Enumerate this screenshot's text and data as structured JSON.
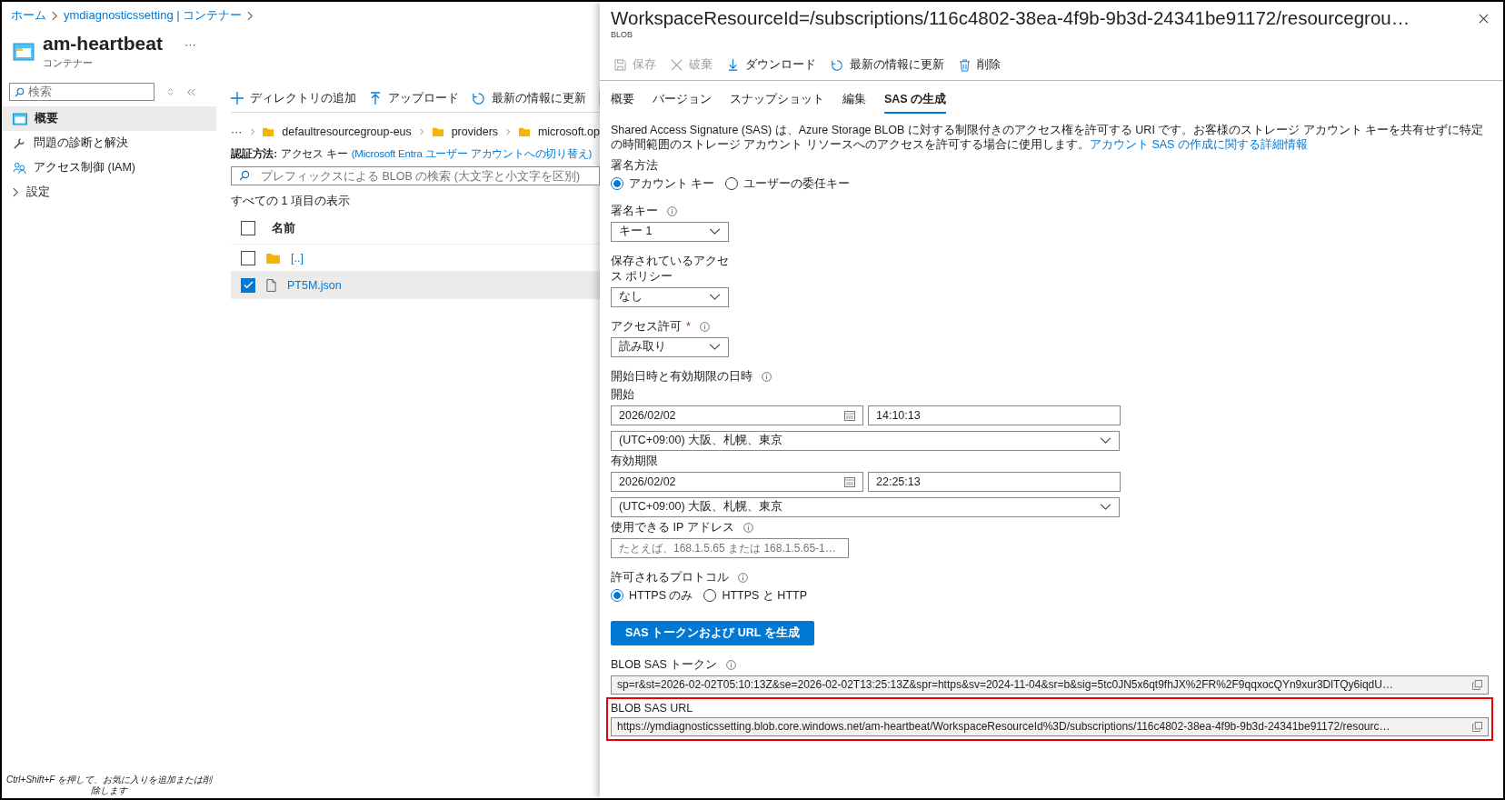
{
  "breadcrumb": [
    "ホーム",
    "ymdiagnosticssetting | コンテナー"
  ],
  "resource": {
    "title": "am-heartbeat",
    "more": "···",
    "subtitle": "コンテナー"
  },
  "sidebar": {
    "search": {
      "placeholder": "検索"
    },
    "items": [
      {
        "label": "概要",
        "selected": true,
        "expandable": false
      },
      {
        "label": "問題の診断と解決",
        "selected": false,
        "expandable": false
      },
      {
        "label": "アクセス制御 (IAM)",
        "selected": false,
        "expandable": false
      },
      {
        "label": "設定",
        "selected": false,
        "expandable": true
      }
    ]
  },
  "toolbar": [
    {
      "label": "ディレクトリの追加"
    },
    {
      "label": "アップロード"
    },
    {
      "label": "最新の情報に更新"
    }
  ],
  "path": {
    "more": "···",
    "folders": [
      "defaultresourcegroup-eus",
      "providers",
      "microsoft.op"
    ]
  },
  "auth": {
    "label": "認証方法:",
    "value": "アクセス キー",
    "link": "(Microsoft Entra ユーザー アカウントへの切り替え)"
  },
  "blob_search": {
    "placeholder": "プレフィックスによる BLOB の検索 (大文字と小文字を区別)"
  },
  "count_text": "すべての 1 項目の表示",
  "table": {
    "header": "名前",
    "header_checked": false,
    "rows": [
      {
        "name": "[..]",
        "kind": "folder",
        "checked": false
      },
      {
        "name": "PT5M.json",
        "kind": "file",
        "checked": true
      }
    ]
  },
  "footer_hint": "Ctrl+Shift+F を押して、お気に入りを追加または削除します",
  "panel": {
    "title": "WorkspaceResourceId=/subscriptions/116c4802-38ea-4f9b-9b3d-24341be91172/resourcegrou…",
    "subtitle": "BLOB",
    "toolbar": [
      {
        "label": "保存",
        "disabled": true
      },
      {
        "label": "破棄",
        "disabled": true
      },
      {
        "label": "ダウンロード",
        "disabled": false
      },
      {
        "label": "最新の情報に更新",
        "disabled": false
      },
      {
        "label": "削除",
        "disabled": false
      }
    ],
    "tabs": [
      {
        "label": "概要",
        "selected": false
      },
      {
        "label": "バージョン",
        "selected": false
      },
      {
        "label": "スナップショット",
        "selected": false
      },
      {
        "label": "編集",
        "selected": false
      },
      {
        "label": "SAS の生成",
        "selected": true
      }
    ],
    "description": "Shared Access Signature (SAS) は、Azure Storage BLOB に対する制限付きのアクセス権を許可する URI です。お客様のストレージ アカウント キーを共有せずに特定の時間範囲のストレージ アカウント リソースへのアクセスを許可する場合に使用します。",
    "description_link": "アカウント SAS の作成に関する詳細情報",
    "fields": [
      {
        "kind": "radio",
        "label": "署名方法",
        "options": [
          {
            "label": "アカウント キー",
            "selected": true
          },
          {
            "label": "ユーザーの委任キー",
            "selected": false
          }
        ]
      },
      {
        "kind": "select",
        "label": "署名キー",
        "info": true,
        "value": "キー 1"
      },
      {
        "kind": "select",
        "label": "保存されているアクセス ポリシー",
        "info": false,
        "value": "なし"
      },
      {
        "kind": "select",
        "label": "アクセス許可",
        "required_mark": "*",
        "info": true,
        "value": "読み取り"
      },
      {
        "kind": "heading",
        "label": "開始日時と有効期限の日時",
        "info": true
      },
      {
        "kind": "datetime",
        "label": "開始",
        "date": "2026/02/02",
        "time": "14:10:13",
        "timezone": "(UTC+09:00) 大阪、札幌、東京"
      },
      {
        "kind": "datetime",
        "label": "有効期限",
        "date": "2026/02/02",
        "time": "22:25:13",
        "timezone": "(UTC+09:00) 大阪、札幌、東京"
      },
      {
        "kind": "text",
        "label": "使用できる IP アドレス",
        "info": true,
        "placeholder": "たとえば、168.1.5.65 または 168.1.5.65-1…"
      },
      {
        "kind": "radio",
        "label": "許可されるプロトコル",
        "info": true,
        "options": [
          {
            "label": "HTTPS のみ",
            "selected": true
          },
          {
            "label": "HTTPS と HTTP",
            "selected": false
          }
        ]
      },
      {
        "kind": "button",
        "label": "SAS トークンおよび URL を生成"
      },
      {
        "kind": "output",
        "label": "BLOB SAS トークン",
        "info": true,
        "highlighted": false,
        "value": "sp=r&st=2026-02-02T05:10:13Z&se=2026-02-02T13:25:13Z&spr=https&sv=2024-11-04&sr=b&sig=5tc0JN5x6qt9fhJX%2FR%2F9qqxocQYn9xur3DlTQy6iqdU…"
      },
      {
        "kind": "output",
        "label": "BLOB SAS URL",
        "info": false,
        "highlighted": true,
        "value": "https://ymdiagnosticssetting.blob.core.windows.net/am-heartbeat/WorkspaceResourceId%3D/subscriptions/116c4802-38ea-4f9b-9b3d-24341be91172/resourc…"
      }
    ]
  }
}
